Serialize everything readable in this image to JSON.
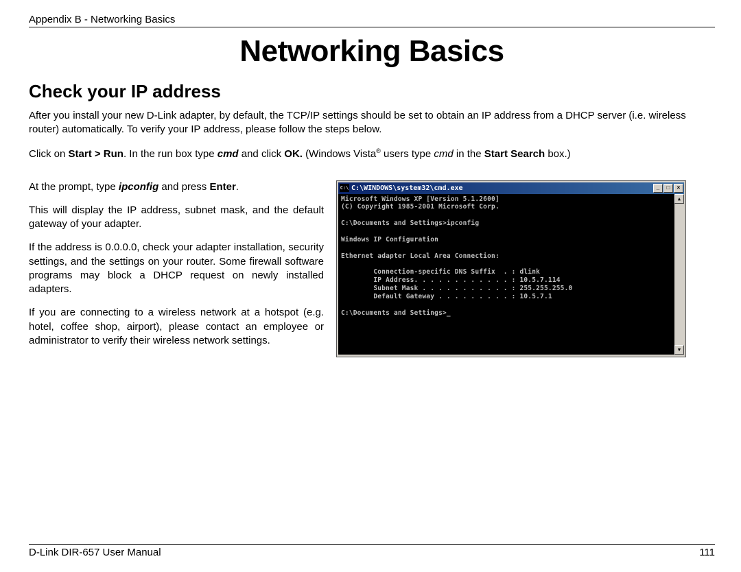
{
  "header": {
    "appendix": "Appendix B - Networking Basics"
  },
  "title": "Networking Basics",
  "section_title": "Check your IP address",
  "intro": {
    "p1": "After you install your new D-Link adapter, by default, the TCP/IP settings should be set to obtain an IP address from a DHCP server (i.e. wireless router) automatically. To verify your IP address, please follow the steps below.",
    "run": {
      "pre": "Click on ",
      "start_run": "Start > Run",
      "mid1": ". In the run box type ",
      "cmd": "cmd",
      "mid2": " and click ",
      "ok": "OK.",
      "mid3": " (Windows Vista",
      "sup": "®",
      "mid4": " users type ",
      "cmd2": "cmd",
      "mid5": " in the ",
      "search": "Start Search",
      "end": " box.)"
    }
  },
  "left": {
    "p1a": "At the prompt, type ",
    "p1b": "ipconfig",
    "p1c": " and press ",
    "p1d": "Enter",
    "p1e": ".",
    "p2": "This will display the IP address, subnet mask, and the default gateway of your adapter.",
    "p3": "If the address is 0.0.0.0, check your adapter installation, security settings, and the settings on your router. Some firewall software programs may block a DHCP request on newly installed adapters.",
    "p4": "If you are connecting to a wireless network at a hotspot (e.g. hotel, coffee shop, airport), please contact an employee or administrator to verify their wireless network settings."
  },
  "cmd": {
    "icon_label": "C:\\",
    "title": "C:\\WINDOWS\\system32\\cmd.exe",
    "min_label": "_",
    "max_label": "□",
    "close_label": "×",
    "scroll_up": "▲",
    "scroll_down": "▼",
    "body": "Microsoft Windows XP [Version 5.1.2600]\n(C) Copyright 1985-2001 Microsoft Corp.\n\nC:\\Documents and Settings>ipconfig\n\nWindows IP Configuration\n\nEthernet adapter Local Area Connection:\n\n        Connection-specific DNS Suffix  . : dlink\n        IP Address. . . . . . . . . . . . : 10.5.7.114\n        Subnet Mask . . . . . . . . . . . : 255.255.255.0\n        Default Gateway . . . . . . . . . : 10.5.7.1\n\nC:\\Documents and Settings>_"
  },
  "footer": {
    "manual": "D-Link DIR-657 User Manual",
    "page": "111"
  }
}
